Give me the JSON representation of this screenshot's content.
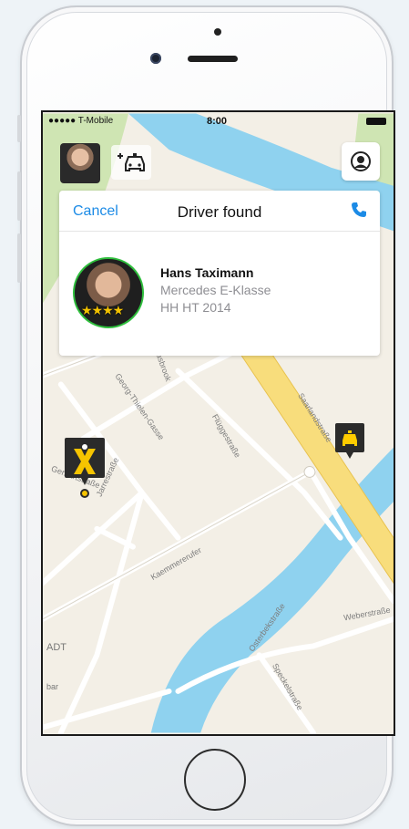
{
  "status_bar": {
    "carrier": "●●●●● T-Mobile",
    "time": "8:00"
  },
  "card": {
    "cancel_label": "Cancel",
    "title": "Driver found",
    "phone_icon": "phone-icon"
  },
  "driver": {
    "name": "Hans Taximann",
    "car": "Mercedes E-Klasse",
    "plate": "HH HT 2014",
    "rating_stars": "★★★★",
    "rating_value": 4
  },
  "map": {
    "streets": {
      "thaden": "Georg-Thielen-Gasse",
      "jarrestr": "Jarrestraße",
      "fluegge": "Flüggestraße",
      "saarland": "Saarlandstraße",
      "kaemmerer": "Kaemmererufer",
      "osterbek": "Osterbekstraße",
      "speckel": "Speckelstraße",
      "weber": "Weberstraße",
      "gerhart": "Gerhartstraße",
      "grasbrook": "Grasbrook"
    },
    "area_labels": {
      "stadt": "ADT",
      "bar": "bar"
    }
  },
  "colors": {
    "accent": "#1c8be6",
    "water": "#8fd2ef",
    "park": "#cfe5b3",
    "highway": "#f8dd7c",
    "taxi_yellow": "#ffcc00",
    "rating_ring": "#2ebe3c"
  },
  "icons": {
    "profile": "user-profile-icon",
    "add_taxi": "add-taxi-icon",
    "taxi_marker": "taxi-marker-icon",
    "pickup_marker": "pickup-marker-icon"
  }
}
